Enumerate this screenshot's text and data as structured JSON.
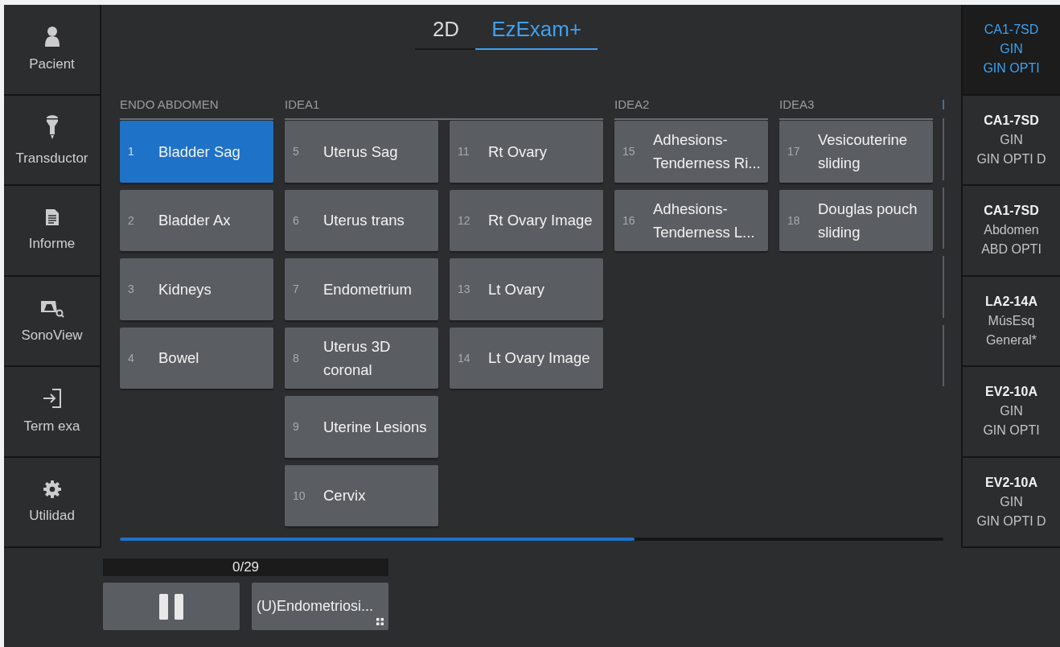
{
  "sidebar": {
    "items": [
      {
        "kind": "patient",
        "label": "Pacient"
      },
      {
        "kind": "probe",
        "label": "Transductor"
      },
      {
        "kind": "report",
        "label": "Informe"
      },
      {
        "kind": "sonoview",
        "label": "SonoView"
      },
      {
        "kind": "end",
        "label": "Term exa"
      },
      {
        "kind": "utility",
        "label": "Utilidad"
      }
    ]
  },
  "tabs": [
    {
      "label": "2D",
      "selected": false
    },
    {
      "label": "EzExam+",
      "selected": true
    }
  ],
  "groups": [
    {
      "header": "ENDO ABDOMEN",
      "columns": [
        [
          {
            "number": "1",
            "label": "Bladder Sag",
            "selected": true
          },
          {
            "number": "2",
            "label": "Bladder Ax",
            "selected": false
          },
          {
            "number": "3",
            "label": "Kidneys",
            "selected": false
          },
          {
            "number": "4",
            "label": "Bowel",
            "selected": false
          }
        ]
      ]
    },
    {
      "header": "IDEA1",
      "columns": [
        [
          {
            "number": "5",
            "label": "Uterus Sag",
            "selected": false
          },
          {
            "number": "6",
            "label": "Uterus trans",
            "selected": false
          },
          {
            "number": "7",
            "label": "Endometrium",
            "selected": false
          },
          {
            "number": "8",
            "label": "Uterus 3D coronal",
            "selected": false
          },
          {
            "number": "9",
            "label": "Uterine Lesions",
            "selected": false
          },
          {
            "number": "10",
            "label": "Cervix",
            "selected": false
          }
        ],
        [
          {
            "number": "11",
            "label": "Rt Ovary",
            "selected": false
          },
          {
            "number": "12",
            "label": "Rt Ovary Image",
            "selected": false
          },
          {
            "number": "13",
            "label": "Lt Ovary",
            "selected": false
          },
          {
            "number": "14",
            "label": "Lt Ovary Image",
            "selected": false
          }
        ]
      ]
    },
    {
      "header": "IDEA2",
      "columns": [
        [
          {
            "number": "15",
            "label": "Adhesions-Tenderness Ri...",
            "selected": false
          },
          {
            "number": "16",
            "label": "Adhesions-Tenderness L...",
            "selected": false
          }
        ]
      ]
    },
    {
      "header": "IDEA3",
      "columns": [
        [
          {
            "number": "17",
            "label": "Vesicouterine sliding",
            "selected": false
          },
          {
            "number": "18",
            "label": "Douglas pouch sliding",
            "selected": false
          }
        ]
      ]
    }
  ],
  "next_group_edge": [
    {
      "kind": "header"
    },
    {
      "kind": "button"
    },
    {
      "kind": "button"
    },
    {
      "kind": "button"
    },
    {
      "kind": "button"
    }
  ],
  "counter": "0/29",
  "controls": [
    {
      "kind": "pause"
    },
    {
      "kind": "protocol",
      "label": "(U)Endometriosi..."
    }
  ],
  "presets": [
    {
      "probe": "CA1-7SD",
      "app": "GIN",
      "preset": "GIN OPTI",
      "selected": true
    },
    {
      "probe": "CA1-7SD",
      "app": "GIN",
      "preset": "GIN OPTI D",
      "selected": false
    },
    {
      "probe": "CA1-7SD",
      "app": "Abdomen",
      "preset": "ABD OPTI",
      "selected": false
    },
    {
      "probe": "LA2-14A",
      "app": "MúsEsq",
      "preset": "General*",
      "selected": false
    },
    {
      "probe": "EV2-10A",
      "app": "GIN",
      "preset": "GIN OPTI",
      "selected": false
    },
    {
      "probe": "EV2-10A",
      "app": "GIN",
      "preset": "GIN OPTI D",
      "selected": false
    }
  ]
}
